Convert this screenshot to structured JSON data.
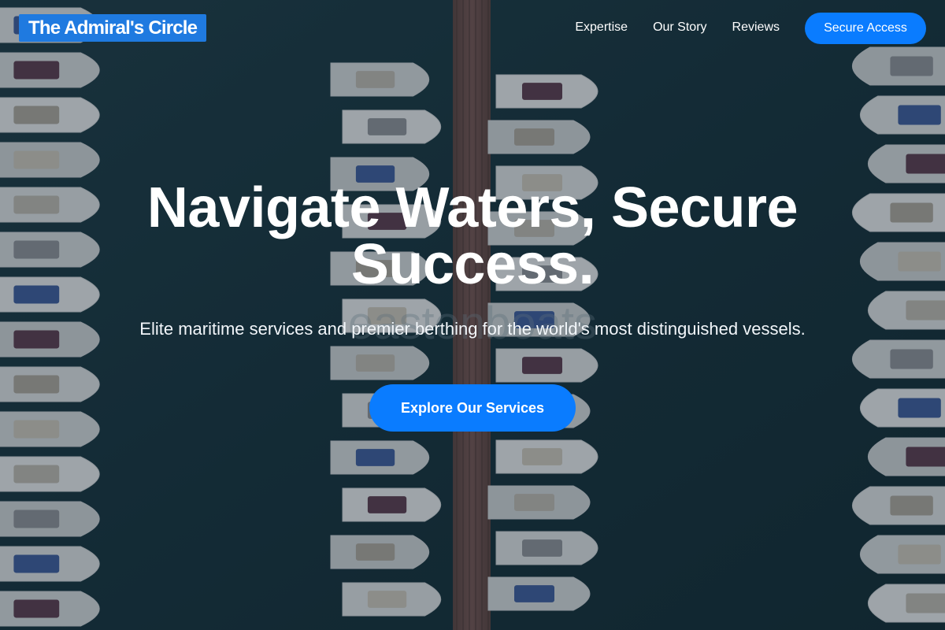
{
  "brand": {
    "name": "The Admiral's Circle"
  },
  "nav": {
    "links": [
      "Expertise",
      "Our Story",
      "Reviews"
    ],
    "cta_label": "Secure Access"
  },
  "hero": {
    "title": "Navigate Waters, Secure Success.",
    "subtitle": "Elite maritime services and premier berthing for the world's most distinguished vessels.",
    "button_label": "Explore Our Services"
  },
  "background": {
    "description_icon": "marina-aerial-image",
    "overlay_color": "#13262f",
    "accent": "#0a7cff",
    "watermark": "eastonboats"
  }
}
